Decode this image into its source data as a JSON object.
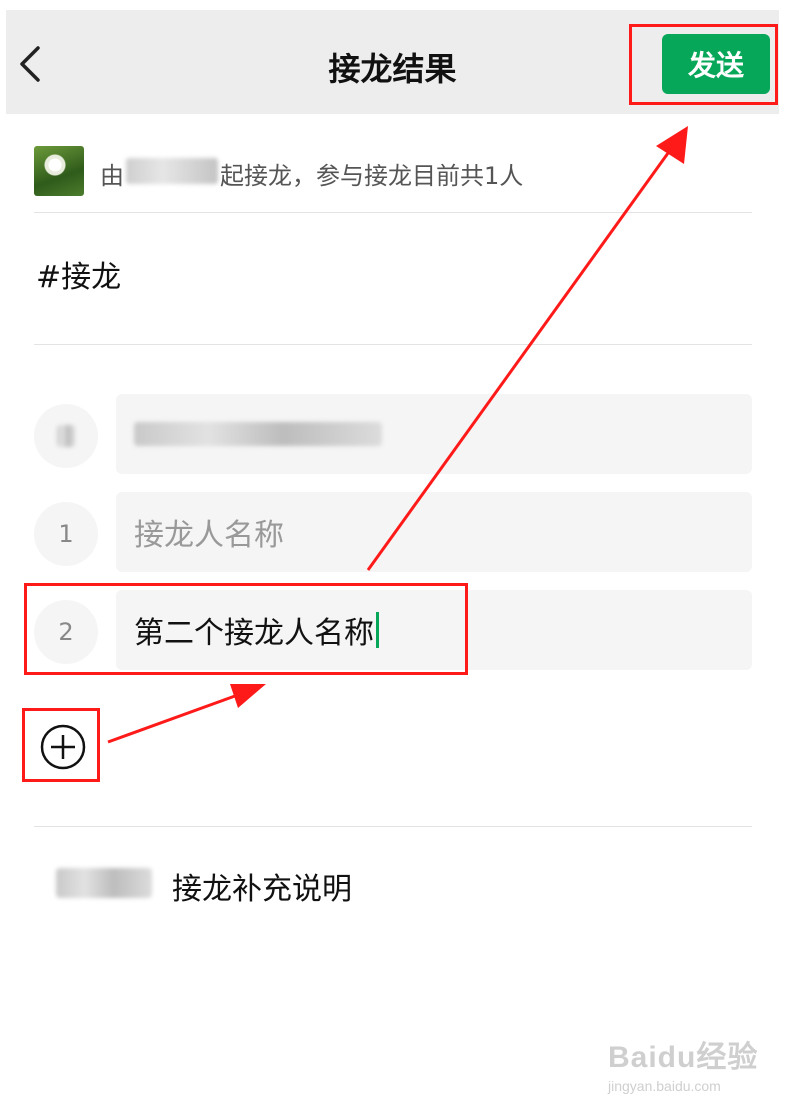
{
  "header": {
    "title": "接龙结果",
    "send_label": "发送"
  },
  "initiator": {
    "prefix": "由",
    "suffix": "起接龙，参与接龙目前共1人"
  },
  "topic": "#接龙",
  "entries": [
    {
      "number": "1",
      "placeholder": "接龙人名称",
      "value": ""
    },
    {
      "number": "2",
      "placeholder": "",
      "value": "第二个接龙人名称"
    }
  ],
  "supplement_label": "接龙补充说明",
  "watermark": {
    "main": "Baidu经验",
    "sub": "jingyan.baidu.com"
  },
  "colors": {
    "accent": "#07a75a",
    "annotation": "#ff1a1a"
  },
  "icons": {
    "back": "chevron-left-icon",
    "add": "plus-circle-icon"
  }
}
